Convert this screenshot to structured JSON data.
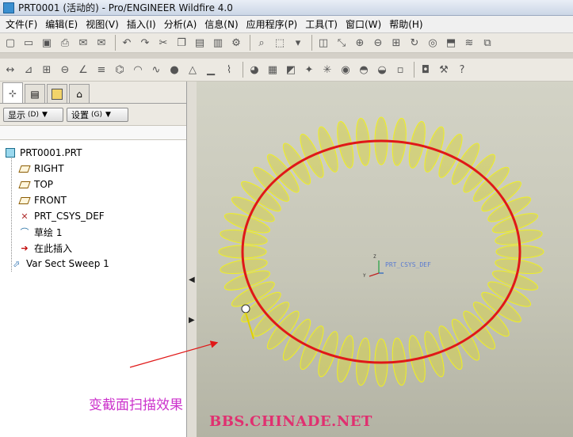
{
  "window": {
    "title": "PRT0001 (活动的) - Pro/ENGINEER Wildfire 4.0"
  },
  "menubar": {
    "items": [
      "文件(F)",
      "编辑(E)",
      "视图(V)",
      "插入(I)",
      "分析(A)",
      "信息(N)",
      "应用程序(P)",
      "工具(T)",
      "窗口(W)",
      "帮助(H)"
    ]
  },
  "toolbar1": {
    "buttons": [
      {
        "icon": "new-file-icon",
        "glyph": "▢"
      },
      {
        "icon": "open-folder-icon",
        "glyph": "▭"
      },
      {
        "icon": "save-icon",
        "glyph": "▣"
      },
      {
        "icon": "print-icon",
        "glyph": "⎙"
      },
      {
        "icon": "email-icon",
        "glyph": "✉"
      },
      {
        "icon": "email-link-icon",
        "glyph": "✉"
      },
      {
        "icon": "undo-icon",
        "glyph": "↶"
      },
      {
        "icon": "redo-icon",
        "glyph": "↷"
      },
      {
        "icon": "cut-icon",
        "glyph": "✂"
      },
      {
        "icon": "copy-icon",
        "glyph": "❐"
      },
      {
        "icon": "paste-icon",
        "glyph": "▤"
      },
      {
        "icon": "paste-special-icon",
        "glyph": "▥"
      },
      {
        "icon": "regenerate-icon",
        "glyph": "⚙"
      },
      {
        "icon": "find-icon",
        "glyph": "⌕"
      },
      {
        "icon": "select-box-icon",
        "glyph": "⬚"
      },
      {
        "icon": "dropdown-icon",
        "glyph": "▾"
      },
      {
        "icon": "refit-icon",
        "glyph": "◫"
      },
      {
        "icon": "datum-display-icon",
        "glyph": "⤡"
      },
      {
        "icon": "zoom-in-icon",
        "glyph": "⊕"
      },
      {
        "icon": "zoom-out-icon",
        "glyph": "⊖"
      },
      {
        "icon": "zoom-window-icon",
        "glyph": "⊞"
      },
      {
        "icon": "repaint-icon",
        "glyph": "↻"
      },
      {
        "icon": "spin-center-icon",
        "glyph": "◎"
      },
      {
        "icon": "view-orient-icon",
        "glyph": "⬒"
      },
      {
        "icon": "layers-icon",
        "glyph": "≋"
      },
      {
        "icon": "view-manager-icon",
        "glyph": "⧉"
      }
    ]
  },
  "toolbar2": {
    "buttons": [
      {
        "icon": "dimension-icon",
        "glyph": "↔"
      },
      {
        "icon": "measure-icon",
        "glyph": "⊿"
      },
      {
        "icon": "table-icon",
        "glyph": "⊞"
      },
      {
        "icon": "circle-icon",
        "glyph": "⊖"
      },
      {
        "icon": "angle-icon",
        "glyph": "∠"
      },
      {
        "icon": "relations-icon",
        "glyph": "≡"
      },
      {
        "icon": "mass-properties-icon",
        "glyph": "⌬"
      },
      {
        "icon": "curvature-icon",
        "glyph": "◠"
      },
      {
        "icon": "wave-analysis-icon",
        "glyph": "∿"
      },
      {
        "icon": "shading-sphere-icon",
        "glyph": "●"
      },
      {
        "icon": "draft-check-icon",
        "glyph": "△"
      },
      {
        "icon": "graph-icon",
        "glyph": "▁"
      },
      {
        "icon": "curve-analysis-icon",
        "glyph": "⌇"
      },
      {
        "icon": "color-palette-icon",
        "glyph": "◕"
      },
      {
        "icon": "scene-icon",
        "glyph": "▦"
      },
      {
        "icon": "surface-analysis-icon",
        "glyph": "◩"
      },
      {
        "icon": "light-bulb-icon",
        "glyph": "✦"
      },
      {
        "icon": "snow-effect-icon",
        "glyph": "✳"
      },
      {
        "icon": "render-icon",
        "glyph": "◉"
      },
      {
        "icon": "hat-shape-icon",
        "glyph": "◓"
      },
      {
        "icon": "disk-icon",
        "glyph": "◒"
      },
      {
        "icon": "white-box-icon",
        "glyph": "▫"
      },
      {
        "icon": "photo-icon",
        "glyph": "◘"
      },
      {
        "icon": "hammer-icon",
        "glyph": "⚒"
      },
      {
        "icon": "context-help-icon",
        "glyph": "?"
      }
    ]
  },
  "navigator": {
    "tabs": [
      {
        "name": "model-tree-tab",
        "glyph": "⊹"
      },
      {
        "name": "folder-browser-tab",
        "glyph": "▤"
      },
      {
        "name": "favorites-tab",
        "glyph": "✱"
      },
      {
        "name": "connections-tab",
        "glyph": "⌂"
      }
    ],
    "display_button": "显示",
    "display_hint": "(D)",
    "settings_button": "设置",
    "settings_hint": "(G)"
  },
  "model_tree": {
    "root": "PRT0001.PRT",
    "items": [
      {
        "label": "RIGHT",
        "icon": "datum-plane-icon"
      },
      {
        "label": "TOP",
        "icon": "datum-plane-icon"
      },
      {
        "label": "FRONT",
        "icon": "datum-plane-icon"
      },
      {
        "label": "PRT_CSYS_DEF",
        "icon": "csys-icon"
      },
      {
        "label": "草绘 1",
        "icon": "sketch-icon"
      },
      {
        "label": "在此插入",
        "icon": "insert-here-icon"
      },
      {
        "label": "Var Sect Sweep 1",
        "icon": "var-sect-sweep-icon"
      }
    ]
  },
  "viewport": {
    "csys_label": "PRT_CSYS_DEF",
    "axis_z": "Z",
    "axis_y": "Y",
    "ring_color": "#e01818",
    "blade_color": "#d6d24a",
    "blade_edge_color": "#f0f020"
  },
  "annotation": {
    "text": "变截面扫描效果",
    "watermark": "BBS.CHINADE.NET",
    "arrow_color": "#e01818"
  }
}
